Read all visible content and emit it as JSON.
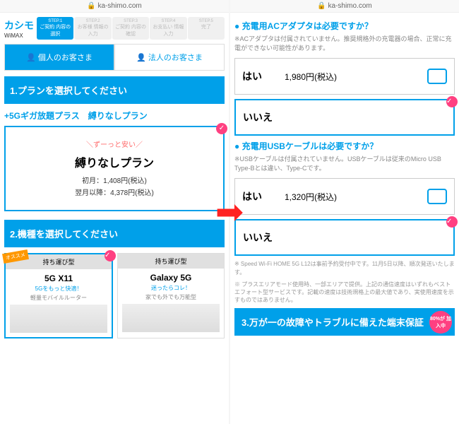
{
  "url": "ka-shimo.com",
  "logo": "カシモ",
  "logo_sub": "WiMAX",
  "steps": [
    {
      "num": "STEP.1",
      "label": "ご契約\n内容の選択"
    },
    {
      "num": "STEP.2",
      "label": "お客様\n情報の入力"
    },
    {
      "num": "STEP.3",
      "label": "ご契約\n内容の確認"
    },
    {
      "num": "STEP.4",
      "label": "お支払い\n情報入力"
    },
    {
      "num": "STEP.5",
      "label": "完了"
    }
  ],
  "tab_personal": "個人のお客さま",
  "tab_business": "法人のお客さま",
  "section1": "1.プランを選択してください",
  "plan_label": "+5Gギガ放題プラス　縛りなしプラン",
  "tagline": "＼ずーっと安い／",
  "plan_name": "縛りなしプラン",
  "plan_first": "初月：1,408円(税込)",
  "plan_after": "翌月以降：4,378円(税込)",
  "section2": "2.機種を選択してください",
  "devices": [
    {
      "type": "持ち運び型",
      "name": "5G X11",
      "tag": "5Gをもっと快適！",
      "desc": "軽量モバイルルーター",
      "badge": "オススメ"
    },
    {
      "type": "持ち運び型",
      "name": "Galaxy 5G",
      "tag": "迷ったらコレ！",
      "desc": "家でも外でも万能型"
    }
  ],
  "q1": "充電用ACアダプタは必要ですか？",
  "q1_note": "※ACアダプタは付属されていません。推奨規格外の充電器の場合、正常に充電ができない可能性があります。",
  "q2": "充電用USBケーブルは必要ですか？",
  "q2_note": "※USBケーブルは付属されていません。USBケーブルは従来のMicro USB Type-Bとは違い、Type-Cです。",
  "opt_yes": "はい",
  "opt_no": "いいえ",
  "price1": "1,980円(税込)",
  "price2": "1,320円(税込)",
  "footnote1": "※ Speed Wi-Fi HOME 5G L12は事前予約受付中です。11月5日以降、順次発送いたします。",
  "footnote2": "※ プラスエリアモード使用時、一部エリアで提供。上記の通信速度はいずれもベストエフォート型サービスです。記載の速度は技術規格上の最大値であり、実使用速度を示すものではありません。",
  "section3": "3.万が一の故障やトラブルに備えた端末保証",
  "wbadge": "80%が\n加入中"
}
